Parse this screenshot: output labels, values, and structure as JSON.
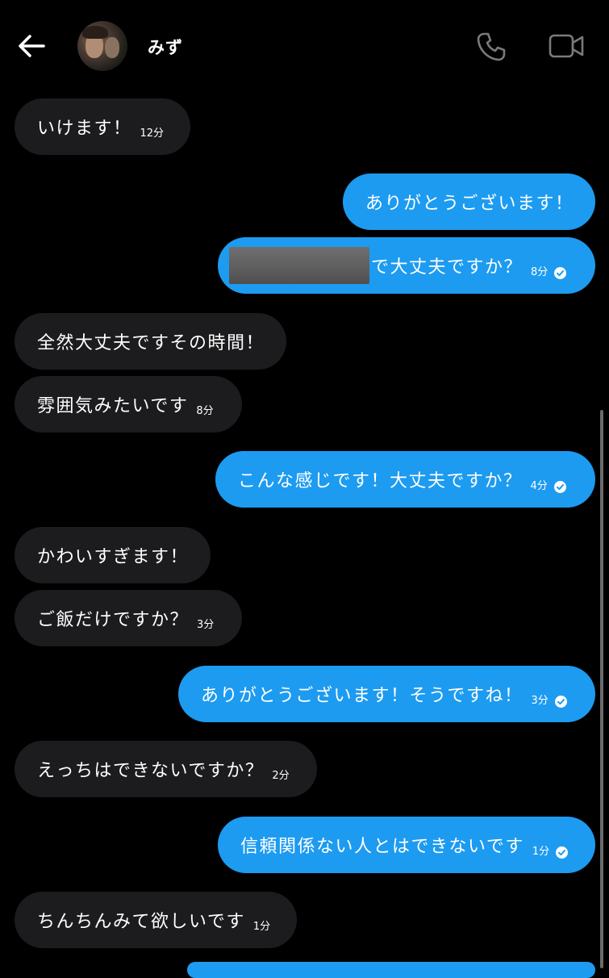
{
  "header": {
    "contact_name": "みず"
  },
  "messages": [
    {
      "side": "in",
      "text": "いけます！",
      "time": "12分"
    },
    {
      "side": "out",
      "text": "ありがとうございます！",
      "time": ""
    },
    {
      "side": "out",
      "text": "で大丈夫ですか？",
      "time": "8分",
      "redacted_prefix": true,
      "read": true
    },
    {
      "side": "in",
      "text": "全然大丈夫ですその時間！",
      "time": ""
    },
    {
      "side": "in",
      "text": "雰囲気みたいです",
      "time": "8分"
    },
    {
      "side": "out",
      "text": "こんな感じです！大丈夫ですか？",
      "time": "4分",
      "read": true
    },
    {
      "side": "in",
      "text": "かわいすぎます！",
      "time": ""
    },
    {
      "side": "in",
      "text": "ご飯だけですか？",
      "time": "3分"
    },
    {
      "side": "out",
      "text": "ありがとうございます！そうですね！",
      "time": "3分",
      "read": true
    },
    {
      "side": "in",
      "text": "えっちはできないですか？",
      "time": "2分"
    },
    {
      "side": "out",
      "text": "信頼関係ない人とはできないです",
      "time": "1分",
      "read": true
    },
    {
      "side": "in",
      "text": "ちんちんみて欲しいです",
      "time": "1分"
    }
  ],
  "colors": {
    "background": "#000000",
    "incoming_bubble": "#1c1c1e",
    "outgoing_bubble": "#1d9bf0",
    "text": "#ffffff"
  },
  "icons": {
    "back": "arrow-left-icon",
    "call": "phone-icon",
    "video": "video-camera-icon",
    "read": "check-circle-icon"
  }
}
